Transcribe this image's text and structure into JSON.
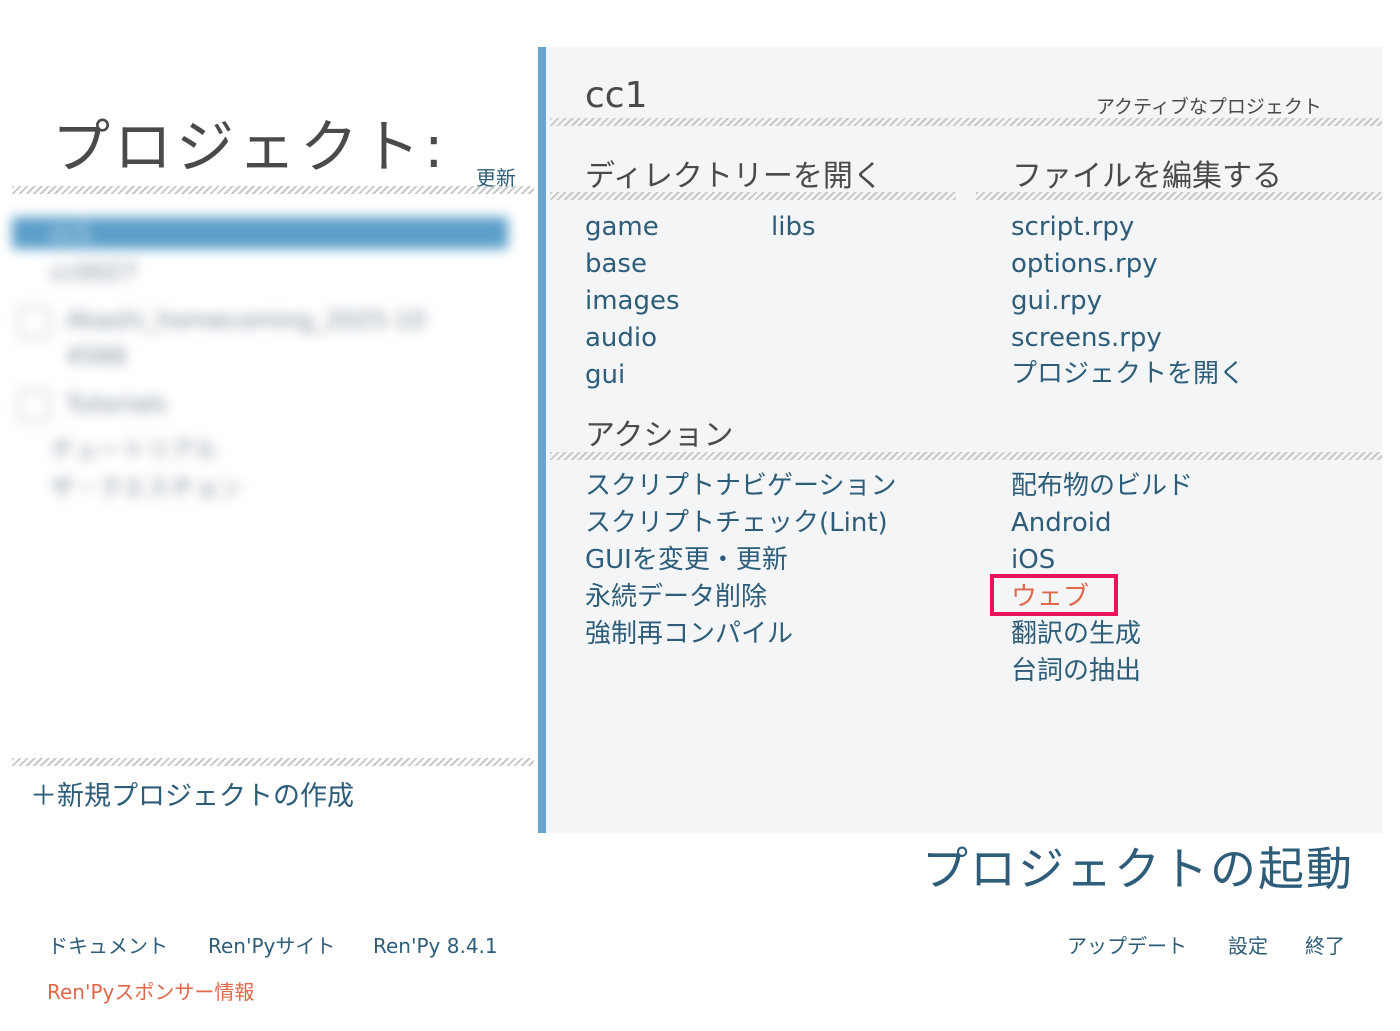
{
  "left_panel": {
    "title": "プロジェクト:",
    "refresh": "更新",
    "projects": [
      {
        "label": "cc1",
        "selected": true
      },
      {
        "label": "cc0027"
      },
      {
        "label": "Akashi_homecoming_2025-10",
        "continued": "4566",
        "checkbox": true
      },
      {
        "label": "Tutorials",
        "checkbox": true
      },
      {
        "label": "チュートリアル"
      },
      {
        "label": "ザ・クエスチョン"
      }
    ],
    "new_project": "＋新規プロジェクトの作成"
  },
  "right_panel": {
    "project_name": "cc1",
    "active_project_label": "アクティブなプロジェクト",
    "open_directory": {
      "heading": "ディレクトリーを開く",
      "col1": [
        "game",
        "base",
        "images",
        "audio",
        "gui"
      ],
      "col2": [
        "libs"
      ]
    },
    "edit_file": {
      "heading": "ファイルを編集する",
      "items": [
        "script.rpy",
        "options.rpy",
        "gui.rpy",
        "screens.rpy",
        "プロジェクトを開く"
      ]
    },
    "actions": {
      "heading": "アクション",
      "col1": [
        "スクリプトナビゲーション",
        "スクリプトチェック(Lint)",
        "GUIを変更・更新",
        "永続データ削除",
        "強制再コンパイル"
      ],
      "col2": [
        "配布物のビルド",
        "Android",
        "iOS",
        "ウェブ",
        "翻訳の生成",
        "台詞の抽出"
      ]
    }
  },
  "launch_button": "プロジェクトの起動",
  "footer": {
    "left": [
      "ドキュメント",
      "Ren'Pyサイト",
      "Ren'Py 8.4.1"
    ],
    "sponsor": "Ren'Pyスポンサー情報",
    "right": [
      "アップデート",
      "設定",
      "終了"
    ]
  },
  "colors": {
    "link": "#2e5d7a",
    "accent_bar": "#6aa6cc",
    "selected_row": "#5a9ec9",
    "highlight_box": "#e8155a",
    "sponsor": "#e0674a"
  }
}
